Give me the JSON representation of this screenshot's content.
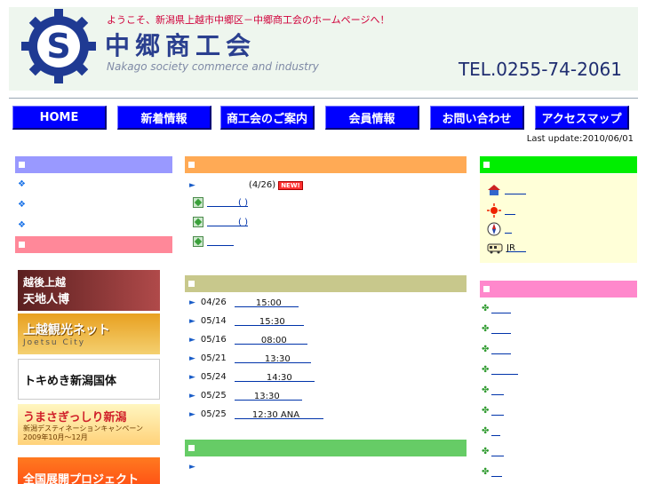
{
  "header": {
    "welcome": "ようこそ、新潟県上越市中郷区－中郷商工会のホームページへ！",
    "title": "中郷商工会",
    "subtitle": "Nakago society commerce and industry",
    "tel": "TEL.0255-74-2061",
    "logo_letter": "S"
  },
  "nav": {
    "items": [
      {
        "label": "HOME"
      },
      {
        "label": "新着情報"
      },
      {
        "label": "商工会のご案内"
      },
      {
        "label": "会員情報"
      },
      {
        "label": "お問い合わせ"
      },
      {
        "label": "アクセスマップ"
      }
    ],
    "last_update": "Last update:2010/06/01"
  },
  "banners": [
    {
      "line1": "越後上越",
      "line2": "天地人博"
    },
    {
      "line1": "上越観光ネット",
      "line2": "Joetsu City"
    },
    {
      "line1": "トキめき新潟国体",
      "line2": ""
    },
    {
      "line1": "うまさぎっしり新潟",
      "line2": "新潟デスティネーションキャンペーン 2009年10月～12月"
    },
    {
      "line1": "全国展開プロジェクト",
      "line2": ""
    }
  ],
  "news": {
    "first_date": "(4/26)",
    "new_badge": "NEW!",
    "links": [
      "(    )",
      "(    )",
      ""
    ]
  },
  "schedule": [
    {
      "date": "04/26",
      "time": "15:00"
    },
    {
      "date": "05/14",
      "time": "15:30"
    },
    {
      "date": "05/16",
      "time": "08:00"
    },
    {
      "date": "05/21",
      "time": "13:30"
    },
    {
      "date": "05/24",
      "time": "14:30"
    },
    {
      "date": "05/25",
      "time": "13:30"
    },
    {
      "date": "05/25",
      "time": "12:30 ANA"
    }
  ],
  "info": {
    "jr_label": "JR"
  },
  "colors": {
    "nav_blue": "#0000ff",
    "left_bar_1": "#9999ff",
    "left_bar_2": "#ff8899",
    "mid_bar_1": "#ffaa55",
    "mid_bar_2": "#c8c88c",
    "mid_bar_3": "#66cc66",
    "right_bar_1": "#00ee00",
    "right_bar_2": "#ff88cc"
  }
}
